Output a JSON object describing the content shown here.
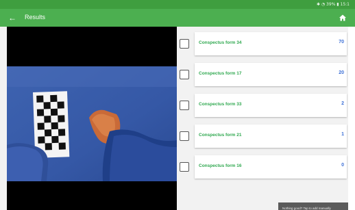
{
  "status_bar": {
    "text": "✱ ◔ 39% ▮ 15:1"
  },
  "app_bar": {
    "title": "Results",
    "back_icon": "arrow-left-icon",
    "home_icon": "home-icon"
  },
  "results": [
    {
      "label": "Conspectus form 34",
      "score": "70",
      "checked": false
    },
    {
      "label": "Conspectus form 17",
      "score": "20",
      "checked": false
    },
    {
      "label": "Conspectus form 33",
      "score": "2",
      "checked": false
    },
    {
      "label": "Conspectus form 21",
      "score": "1",
      "checked": false
    },
    {
      "label": "Conspectus form 16",
      "score": "0",
      "checked": false
    }
  ],
  "snackbar": {
    "text": "Nothing good? Tap to add manually"
  },
  "colors": {
    "accent": "#4caf50",
    "label_green": "#2fa84f",
    "score_blue": "#3b6fd6"
  }
}
